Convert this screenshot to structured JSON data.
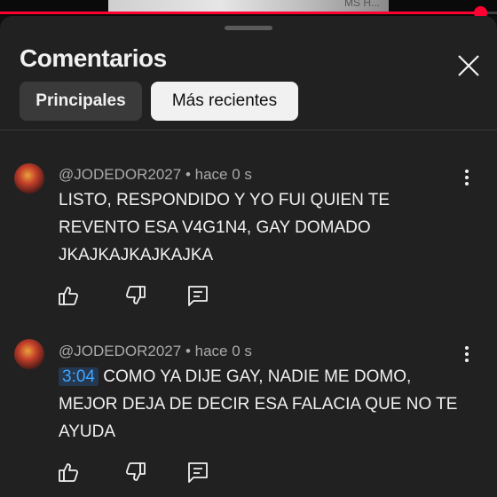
{
  "video": {
    "thumb_text": "MS H...",
    "progress": 0.966
  },
  "panel": {
    "title": "Comentarios",
    "close_icon": "close-icon"
  },
  "filters": [
    {
      "label": "Principales",
      "selected": false
    },
    {
      "label": "Más recientes",
      "selected": true
    }
  ],
  "comments": [
    {
      "author": "@JODEDOR2027",
      "time": "hace 0 s",
      "timestamp": "",
      "text": "LISTO, RESPONDIDO Y YO FUI QUIEN TE REVENTO ESA V4G1N4, GAY DOMADO JKAJKAJKAJKAJKA"
    },
    {
      "author": "@JODEDOR2027",
      "time": "hace 0 s",
      "timestamp": "3:04",
      "text": "COMO YA DIJE GAY, NADIE ME DOMO, MEJOR DEJA DE DECIR ESA FALACIA QUE NO TE AYUDA"
    }
  ],
  "colors": {
    "accent_red": "#ff0033",
    "timestamp_blue": "#3ea6ff",
    "sheet_bg": "#212121"
  }
}
